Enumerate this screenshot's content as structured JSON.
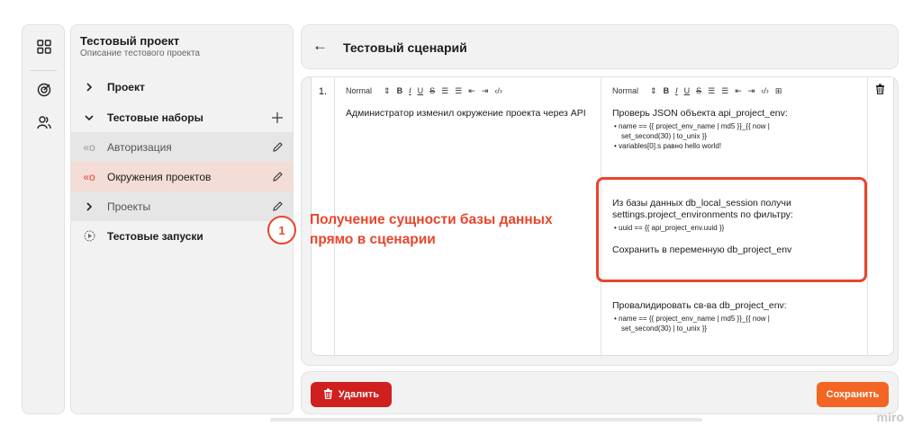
{
  "project": {
    "title": "Тестовый проект",
    "subtitle": "Описание тестового проекта"
  },
  "rail": {
    "icons": [
      "grid-icon",
      "target-icon",
      "users-icon"
    ]
  },
  "sidebar": {
    "items": [
      {
        "lead": "›",
        "label": "Проект"
      },
      {
        "lead": "⌄",
        "label": "Тестовые наборы",
        "trail": "+"
      },
      {
        "lead": "«o",
        "label": "Авторизация"
      },
      {
        "lead": "«o",
        "label": "Окружения проектов"
      },
      {
        "lead": "›",
        "label": "Проекты"
      },
      {
        "lead": "▶",
        "label": "Тестовые запуски"
      }
    ]
  },
  "header": {
    "back": "←",
    "title": "Тестовый сценарий"
  },
  "step": {
    "number": "1.",
    "toolbar_style": "Normal",
    "action_text": "Администратор изменил окружение проекта через API",
    "expected": {
      "p1": "Проверь JSON объекта api_project_env:",
      "p1_bullets": [
        "• name == {{ project_env_name | md5 }}_{{ now |",
        "set_second(30) | to_unix }}",
        "• variables[0].s равно hello world!"
      ],
      "p2_line1": "Из базы данных db_local_session получи",
      "p2_line2": "settings.project_environments по фильтру:",
      "p2_bullet": "• uuid == {{ api_project_env.uuid }}",
      "p3": "Сохранить в переменную db_project_env",
      "p4": "Провалидировать св-ва db_project_env:",
      "p4_bullets": [
        "• name == {{ project_env_name | md5 }}_{{ now |",
        "set_second(30) | to_unix }}"
      ]
    }
  },
  "footer": {
    "delete_label": "Удалить",
    "save_label": "Сохранить"
  },
  "annotation": {
    "number": "1",
    "text": "Получение сущности базы данных прямо в сценарии"
  },
  "watermark": "miro",
  "colors": {
    "accent": "#f26522",
    "danger": "#cf1f1f",
    "annotation": "#e8452c",
    "active_row": "#f4ddd6"
  }
}
